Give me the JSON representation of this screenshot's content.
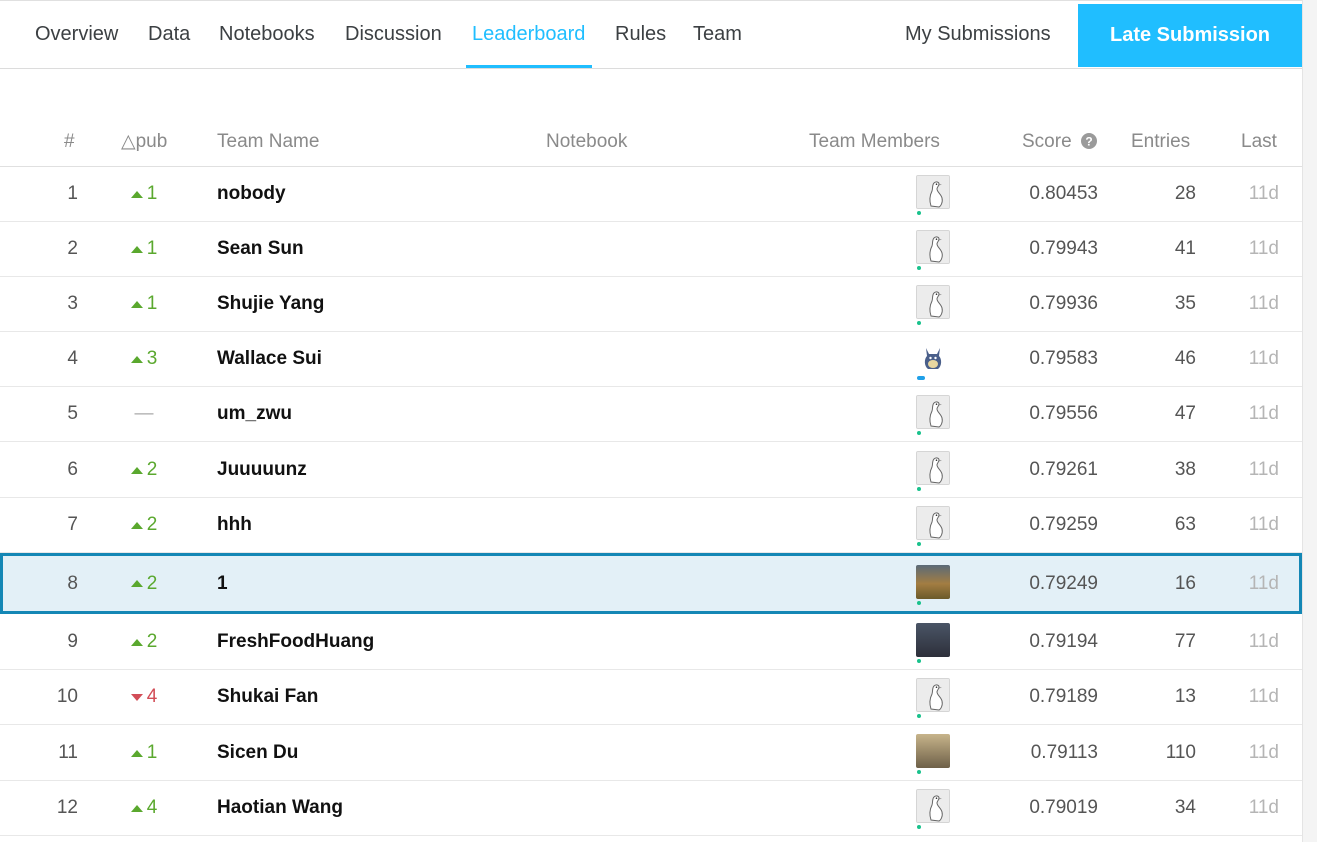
{
  "nav": {
    "tabs": [
      {
        "label": "Overview",
        "active": false
      },
      {
        "label": "Data",
        "active": false
      },
      {
        "label": "Notebooks",
        "active": false
      },
      {
        "label": "Discussion",
        "active": false
      },
      {
        "label": "Leaderboard",
        "active": true
      },
      {
        "label": "Rules",
        "active": false
      },
      {
        "label": "Team",
        "active": false
      }
    ],
    "my_submissions": "My Submissions",
    "late_submission": "Late Submission"
  },
  "table": {
    "headers": {
      "rank": "#",
      "delta": "△pub",
      "team_name": "Team Name",
      "notebook": "Notebook",
      "team_members": "Team Members",
      "score": "Score",
      "entries": "Entries",
      "last": "Last"
    },
    "rows": [
      {
        "rank": "1",
        "dir": "up",
        "delta": "1",
        "team": "nobody",
        "avatar": "goose-icon",
        "score": "0.80453",
        "entries": "28",
        "last": "11d"
      },
      {
        "rank": "2",
        "dir": "up",
        "delta": "1",
        "team": "Sean Sun",
        "avatar": "goose-icon",
        "score": "0.79943",
        "entries": "41",
        "last": "11d"
      },
      {
        "rank": "3",
        "dir": "up",
        "delta": "1",
        "team": "Shujie Yang",
        "avatar": "goose-icon",
        "score": "0.79936",
        "entries": "35",
        "last": "11d"
      },
      {
        "rank": "4",
        "dir": "up",
        "delta": "3",
        "team": "Wallace Sui",
        "avatar": "monster-icon",
        "score": "0.79583",
        "entries": "46",
        "last": "11d"
      },
      {
        "rank": "5",
        "dir": "same",
        "delta": "—",
        "team": "um_zwu",
        "avatar": "goose-icon",
        "score": "0.79556",
        "entries": "47",
        "last": "11d"
      },
      {
        "rank": "6",
        "dir": "up",
        "delta": "2",
        "team": "Juuuuunz",
        "avatar": "goose-icon",
        "score": "0.79261",
        "entries": "38",
        "last": "11d"
      },
      {
        "rank": "7",
        "dir": "up",
        "delta": "2",
        "team": "hhh",
        "avatar": "goose-icon",
        "score": "0.79259",
        "entries": "63",
        "last": "11d"
      },
      {
        "rank": "8",
        "dir": "up",
        "delta": "2",
        "team": "1",
        "avatar": "sunset-photo",
        "score": "0.79249",
        "entries": "16",
        "last": "11d",
        "highlight": true
      },
      {
        "rank": "9",
        "dir": "up",
        "delta": "2",
        "team": "FreshFoodHuang",
        "avatar": "person-photo",
        "score": "0.79194",
        "entries": "77",
        "last": "11d"
      },
      {
        "rank": "10",
        "dir": "down",
        "delta": "4",
        "team": "Shukai Fan",
        "avatar": "goose-icon",
        "score": "0.79189",
        "entries": "13",
        "last": "11d"
      },
      {
        "rank": "11",
        "dir": "up",
        "delta": "1",
        "team": "Sicen Du",
        "avatar": "person2-photo",
        "score": "0.79113",
        "entries": "110",
        "last": "11d"
      },
      {
        "rank": "12",
        "dir": "up",
        "delta": "4",
        "team": "Haotian Wang",
        "avatar": "goose-icon",
        "score": "0.79019",
        "entries": "34",
        "last": "11d"
      }
    ]
  },
  "colors": {
    "accent": "#20beff",
    "up": "#5aa82e",
    "down": "#d24d57",
    "highlight_bg": "#e3f0f7",
    "highlight_border": "#1487b5"
  }
}
